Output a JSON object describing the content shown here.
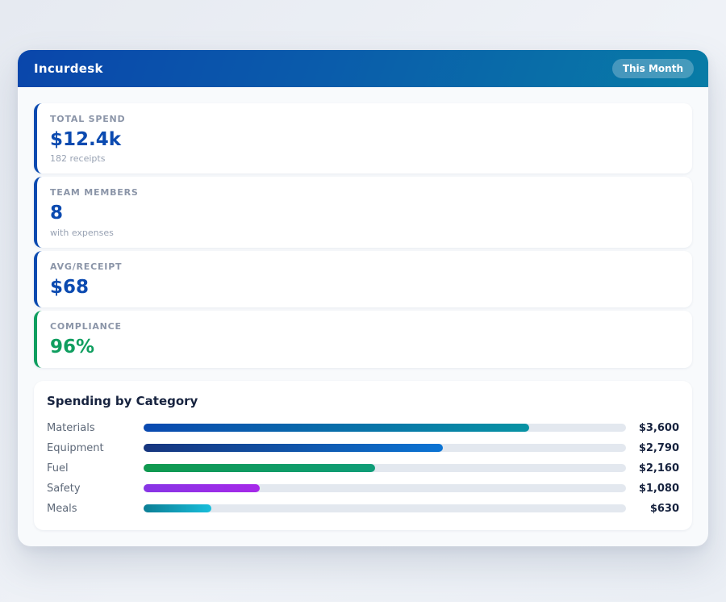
{
  "header": {
    "app_title": "Incurdesk",
    "period_badge": "This Month"
  },
  "colors": {
    "header_gradient_start": "#0a46ab",
    "header_gradient_end": "#087ca6",
    "accent_blue": "#0b4ab0",
    "accent_green": "#0f9e5f",
    "bar_track": "#e3e8ef",
    "text_dark": "#17233f"
  },
  "stats": [
    {
      "label": "TOTAL SPEND",
      "value": "$12.4k",
      "sub": "182 receipts",
      "accent": "#0b4ab0",
      "value_color": "#0b4ab0"
    },
    {
      "label": "TEAM MEMBERS",
      "value": "8",
      "sub": "with expenses",
      "accent": "#0b4ab0",
      "value_color": "#0b4ab0"
    },
    {
      "label": "AVG/RECEIPT",
      "value": "$68",
      "sub": "",
      "accent": "#0b4ab0",
      "value_color": "#0b4ab0"
    },
    {
      "label": "COMPLIANCE",
      "value": "96%",
      "sub": "",
      "accent": "#0f9e5f",
      "value_color": "#0f9e5f"
    }
  ],
  "chart_data": {
    "type": "bar",
    "orientation": "horizontal",
    "title": "Spending by Category",
    "categories": [
      "Materials",
      "Equipment",
      "Fuel",
      "Safety",
      "Meals"
    ],
    "values": [
      3600,
      2790,
      2160,
      1080,
      630
    ],
    "value_labels": [
      "$3,600",
      "$2,790",
      "$2,160",
      "$1,080",
      "$630"
    ],
    "axis_max": 4500,
    "grid": false,
    "legend": false,
    "bar_gradients": [
      [
        "#0a49b0",
        "#0893a4"
      ],
      [
        "#16357e",
        "#0b74d4"
      ],
      [
        "#10994f",
        "#0f9d78"
      ],
      [
        "#8735e5",
        "#a629e9"
      ],
      [
        "#0c7e95",
        "#18bedb"
      ]
    ]
  }
}
